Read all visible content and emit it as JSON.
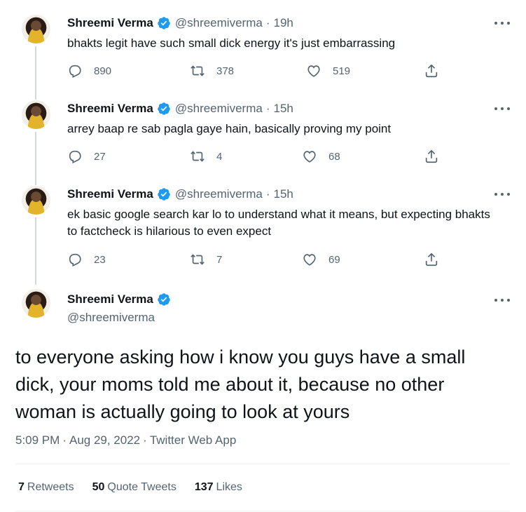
{
  "author": {
    "name": "Shreemi Verma",
    "handle": "@shreemiverma",
    "verified": true
  },
  "thread": [
    {
      "time": "19h",
      "text": "bhakts legit have such small dick energy it's just embarrassing",
      "replies": "890",
      "retweets": "378",
      "likes": "519"
    },
    {
      "time": "15h",
      "text": "arrey baap re sab pagla gaye hain, basically proving my point",
      "replies": "27",
      "retweets": "4",
      "likes": "68"
    },
    {
      "time": "15h",
      "text": "ek basic google search kar lo to understand what it means, but expecting bhakts to factcheck is hilarious to even expect",
      "replies": "23",
      "retweets": "7",
      "likes": "69"
    }
  ],
  "focal": {
    "text": "to everyone asking how i know you guys have a small dick, your moms told me about it, because no other woman is actually going to look at yours",
    "time": "5:09 PM",
    "date": "Aug 29, 2022",
    "source": "Twitter Web App",
    "stats": {
      "retweets_count": "7",
      "retweets_label": "Retweets",
      "quotes_count": "50",
      "quotes_label": "Quote Tweets",
      "likes_count": "137",
      "likes_label": "Likes"
    }
  },
  "dot_separator": "·",
  "colors": {
    "text_primary": "#0f1419",
    "text_secondary": "#536471",
    "verified_blue": "#1d9bf0",
    "thread_line": "#cfd9de"
  }
}
